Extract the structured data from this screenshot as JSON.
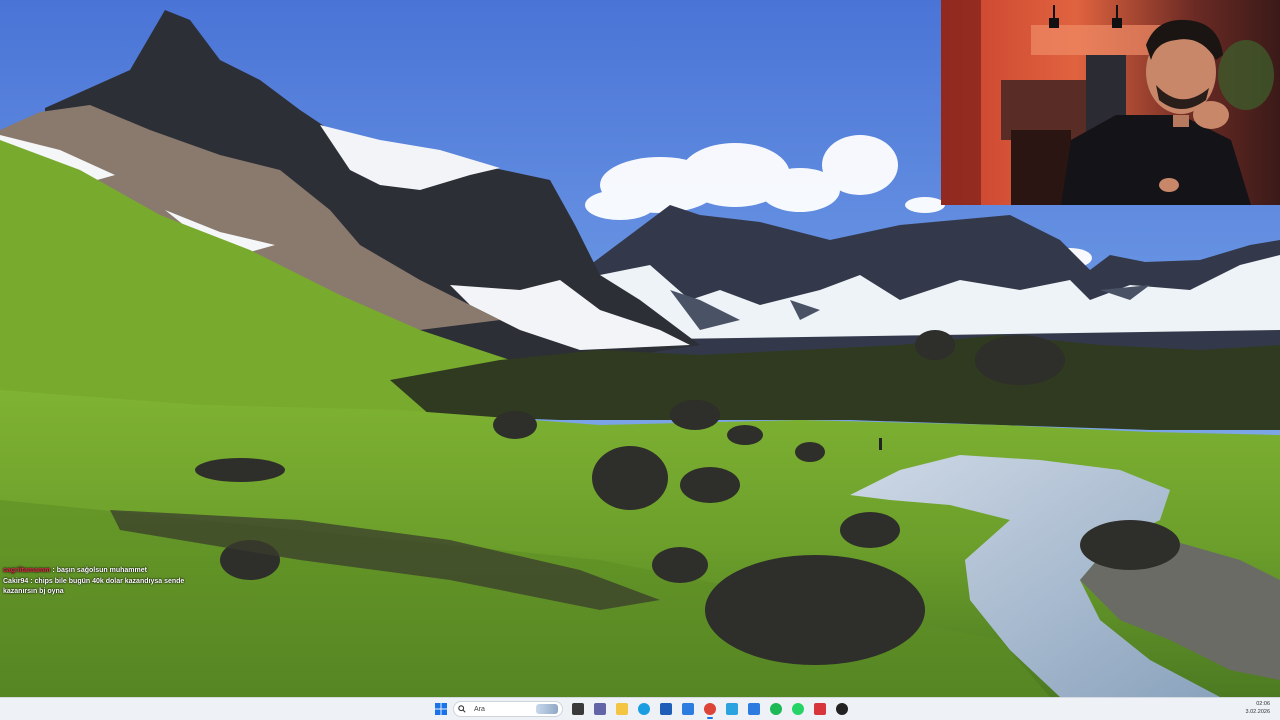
{
  "chat": {
    "messages": [
      {
        "user": "cagriitamamm",
        "separator": " : ",
        "text": "başın sağolsun muhammet"
      },
      {
        "user": "Cakir94",
        "separator": " : ",
        "text": "chips bile bugün 40k dolar kazandıysa sende kazanırsın bj oyna"
      }
    ]
  },
  "taskbar": {
    "search_placeholder": "Ara",
    "pinned_apps": [
      {
        "name": "task-view",
        "color": "#3a3a3a"
      },
      {
        "name": "teams",
        "color": "#6264a7"
      },
      {
        "name": "file-explorer",
        "color": "#f4c542"
      },
      {
        "name": "edge",
        "color": "#1b9de2"
      },
      {
        "name": "store",
        "color": "#1f5fb7"
      },
      {
        "name": "mail",
        "color": "#2b7de0"
      },
      {
        "name": "chrome",
        "color": "#db4437"
      },
      {
        "name": "telegram",
        "color": "#2aa3df"
      },
      {
        "name": "maps",
        "color": "#2d7be0"
      },
      {
        "name": "spotify",
        "color": "#1db954"
      },
      {
        "name": "whatsapp",
        "color": "#25d366"
      },
      {
        "name": "app-red",
        "color": "#d8343c"
      },
      {
        "name": "obs",
        "color": "#222222"
      }
    ],
    "clock": {
      "time": "02:06",
      "date": "3.02.2026"
    }
  }
}
